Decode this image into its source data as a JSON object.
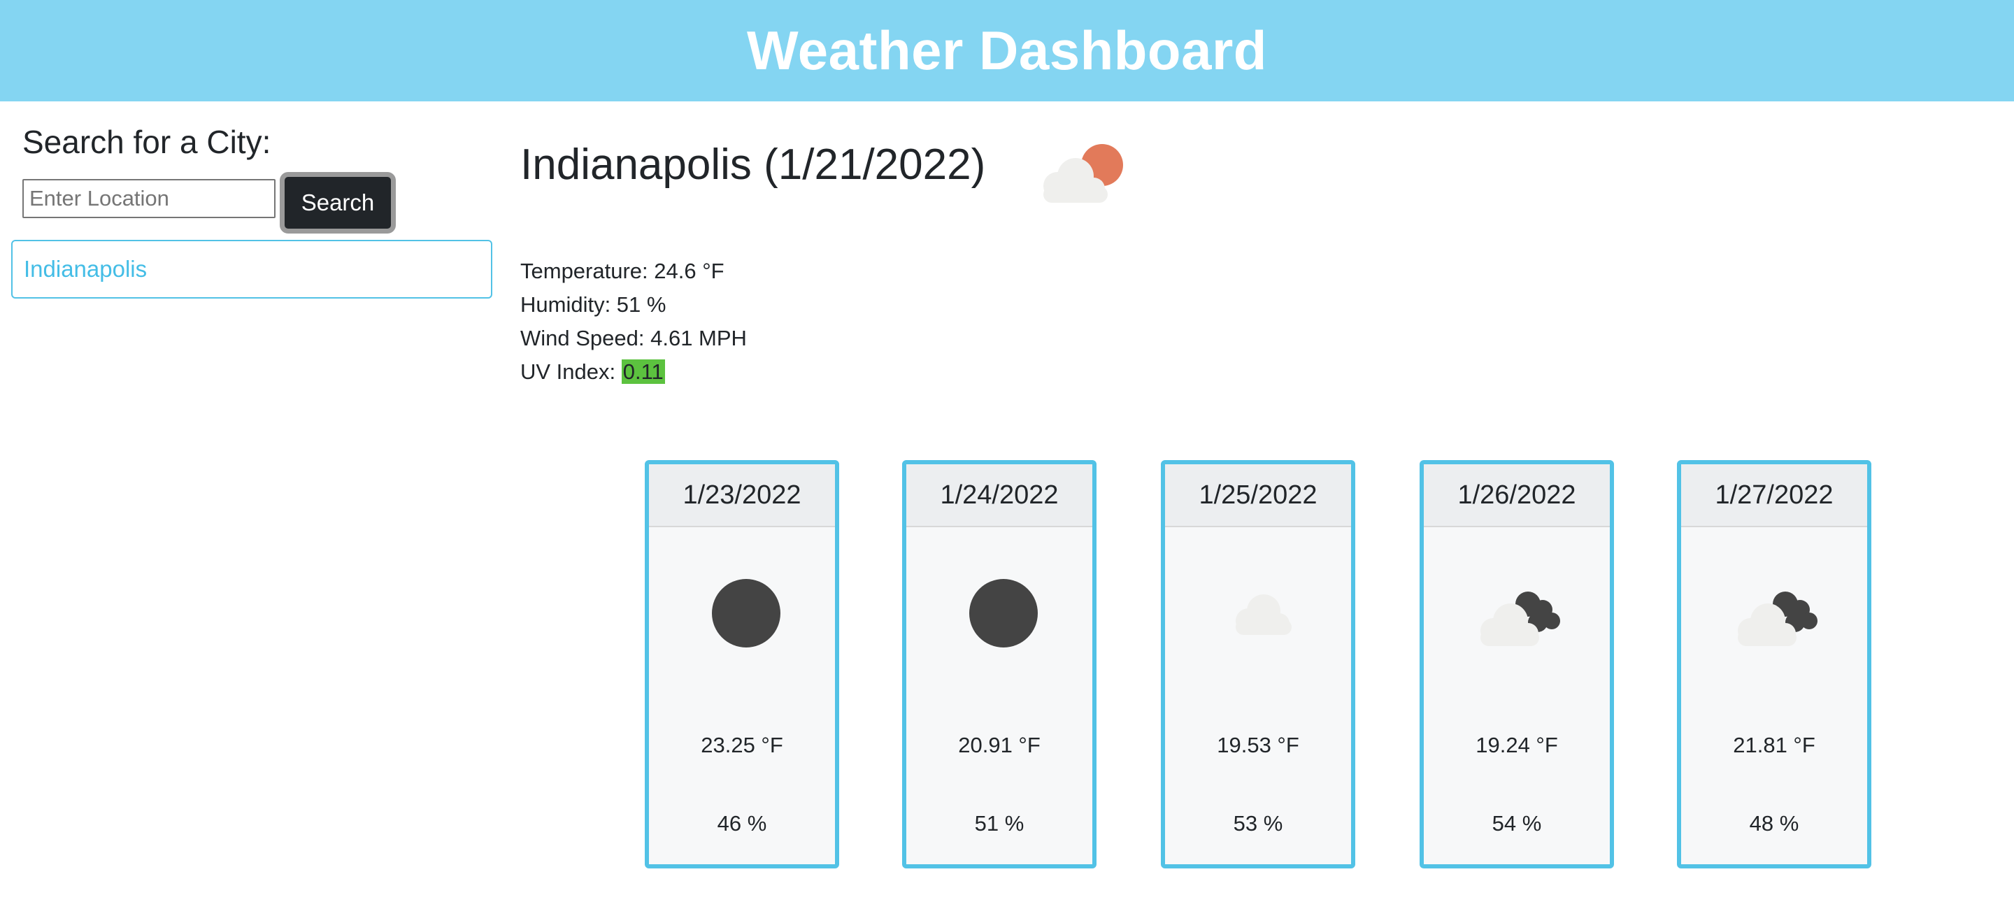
{
  "header": {
    "title": "Weather Dashboard"
  },
  "search": {
    "title": "Search for a City:",
    "placeholder": "Enter Location",
    "value": "",
    "button_label": "Search",
    "history": [
      "Indianapolis"
    ]
  },
  "current": {
    "title": "Indianapolis (1/21/2022)",
    "icon": "few-clouds-icon",
    "temperature": "Temperature: 24.6 °F",
    "humidity": "Humidity: 51 %",
    "wind": "Wind Speed: 4.61 MPH",
    "uv_label": "UV Index: ",
    "uv_value": "0.11",
    "uv_color": "#5cc23f"
  },
  "forecast": [
    {
      "date": "1/23/2022",
      "icon": "clear-night-icon",
      "temp": "23.25 °F",
      "humidity": "46 %"
    },
    {
      "date": "1/24/2022",
      "icon": "clear-night-icon",
      "temp": "20.91 °F",
      "humidity": "51 %"
    },
    {
      "date": "1/25/2022",
      "icon": "cloud-icon",
      "temp": "19.53 °F",
      "humidity": "53 %"
    },
    {
      "date": "1/26/2022",
      "icon": "broken-clouds-icon",
      "temp": "19.24 °F",
      "humidity": "54 %"
    },
    {
      "date": "1/27/2022",
      "icon": "broken-clouds-icon",
      "temp": "21.81 °F",
      "humidity": "48 %"
    }
  ],
  "colors": {
    "header_bg": "#84d5f2",
    "card_border": "#52c2e6",
    "link": "#44bde6",
    "button_bg": "#212529",
    "sun": "#e27a5a"
  }
}
